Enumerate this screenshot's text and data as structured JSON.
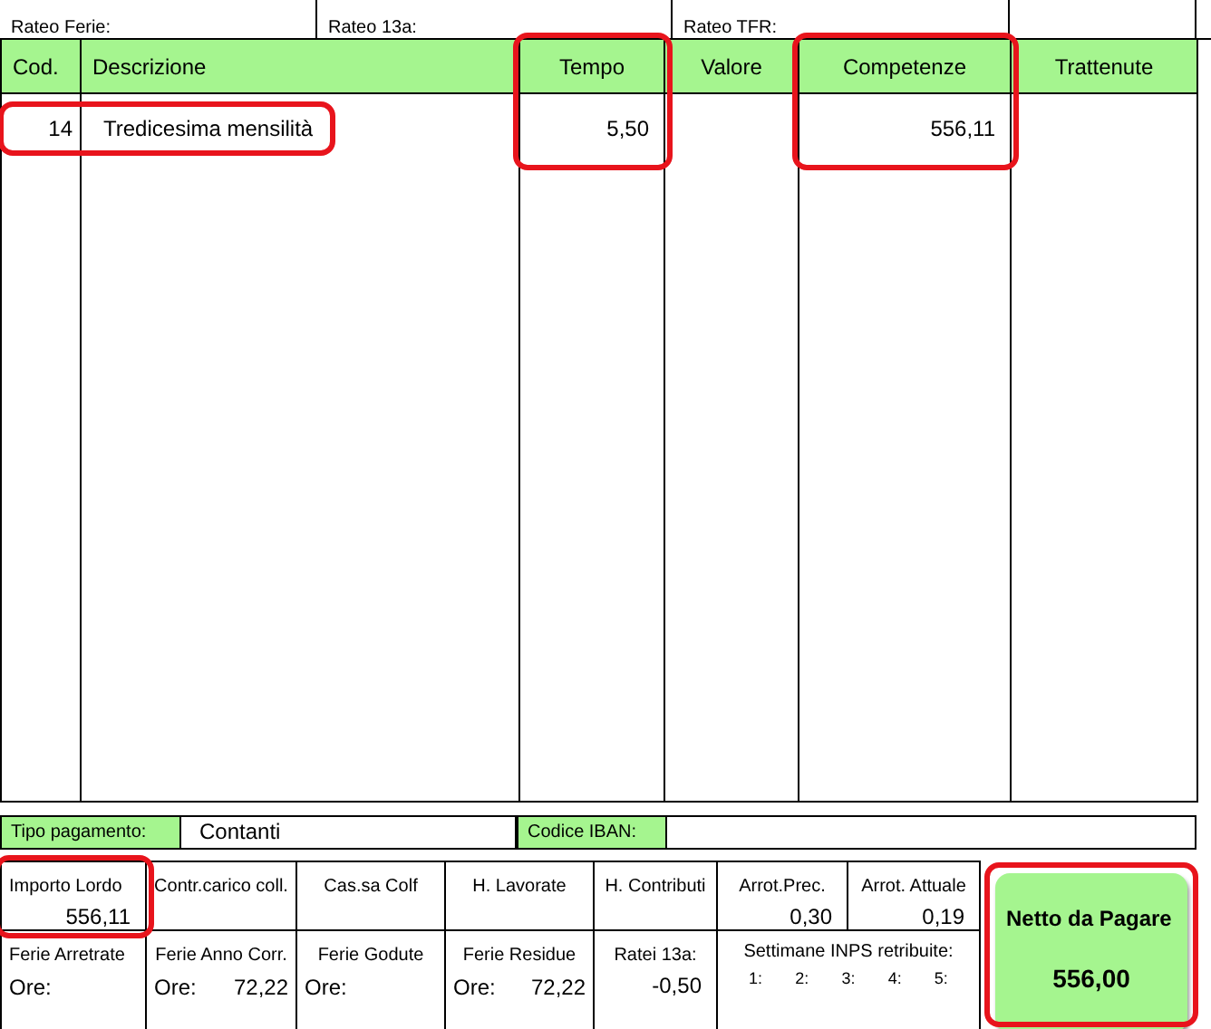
{
  "summary_row": [
    {
      "label": "Rateo Ferie:"
    },
    {
      "label": "Rateo 13a:"
    },
    {
      "label": "Rateo TFR:"
    }
  ],
  "columns": [
    {
      "label": "Cod.",
      "highlight": false
    },
    {
      "label": "Descrizione",
      "highlight": false
    },
    {
      "label": "Tempo",
      "highlight": true
    },
    {
      "label": "Valore",
      "highlight": false
    },
    {
      "label": "Competenze",
      "highlight": true
    },
    {
      "label": "Trattenute",
      "highlight": false
    }
  ],
  "rows": [
    {
      "cod": "14",
      "descrizione": "Tredicesima mensilità",
      "tempo": "5,50",
      "competenze": "556,11",
      "highlight": true
    }
  ],
  "payment": {
    "tipo_label": "Tipo pagamento:",
    "tipo_value": "Contanti",
    "iban_label": "Codice IBAN:"
  },
  "totals": [
    [
      {
        "kind": "amount",
        "label": "Importo Lordo",
        "value": "556,11",
        "highlight": true
      },
      {
        "kind": "amount",
        "label": "Contr.carico coll."
      },
      {
        "kind": "amount",
        "label": "Cas.sa Colf"
      },
      {
        "kind": "amount",
        "label": "H. Lavorate"
      },
      {
        "kind": "amount",
        "label": "H. Contributi"
      },
      {
        "kind": "amount",
        "label": "Arrot.Prec.",
        "value": "0,30"
      },
      {
        "kind": "amount",
        "label": "Arrot. Attuale",
        "value": "0,19"
      }
    ],
    [
      {
        "kind": "hours",
        "label": "Ferie Arretrate",
        "unit": "Ore:"
      },
      {
        "kind": "hours",
        "label": "Ferie Anno Corr.",
        "unit": "Ore:",
        "value": "72,22"
      },
      {
        "kind": "hours",
        "label": "Ferie Godute",
        "unit": "Ore:"
      },
      {
        "kind": "hours",
        "label": "Ferie Residue",
        "unit": "Ore:",
        "value": "72,22"
      },
      {
        "kind": "amount",
        "label": "Ratei 13a:",
        "value": "-0,50"
      },
      {
        "kind": "weeks",
        "label": "Settimane INPS retribuite:",
        "weeks": [
          "1:",
          "2:",
          "3:",
          "4:",
          "5:"
        ]
      }
    ]
  ],
  "netto": {
    "label": "Netto da Pagare",
    "value": "556,00",
    "highlight": true
  }
}
